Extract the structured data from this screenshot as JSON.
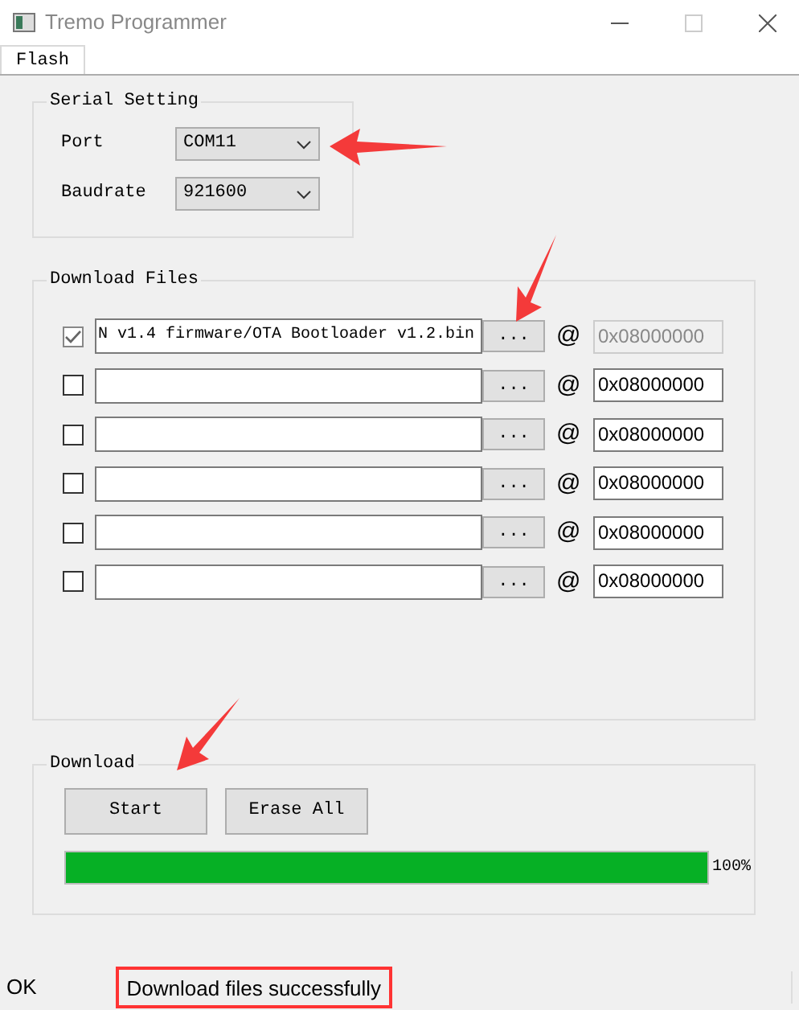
{
  "window": {
    "title": "Tremo Programmer"
  },
  "tabs": [
    {
      "label": "Flash",
      "selected": true
    }
  ],
  "serial_setting": {
    "title": "Serial Setting",
    "fields": [
      {
        "label": "Port",
        "value": "COM11"
      },
      {
        "label": "Baudrate",
        "value": "921600"
      }
    ]
  },
  "download_files": {
    "title": "Download Files",
    "rows": [
      {
        "checked": true,
        "file": "N v1.4 firmware/OTA Bootloader v1.2.bin",
        "browse": "...",
        "at": "@",
        "address": "0x08000000",
        "address_disabled": true
      },
      {
        "checked": false,
        "file": "",
        "browse": "...",
        "at": "@",
        "address": "0x08000000",
        "address_disabled": false
      },
      {
        "checked": false,
        "file": "",
        "browse": "...",
        "at": "@",
        "address": "0x08000000",
        "address_disabled": false
      },
      {
        "checked": false,
        "file": "",
        "browse": "...",
        "at": "@",
        "address": "0x08000000",
        "address_disabled": false
      },
      {
        "checked": false,
        "file": "",
        "browse": "...",
        "at": "@",
        "address": "0x08000000",
        "address_disabled": false
      },
      {
        "checked": false,
        "file": "",
        "browse": "...",
        "at": "@",
        "address": "0x08000000",
        "address_disabled": false
      }
    ]
  },
  "download": {
    "title": "Download",
    "buttons": [
      "Start",
      "Erase All"
    ],
    "progress": {
      "level": 1.0,
      "reading": "100%"
    }
  },
  "status_bar": {
    "state": "OK",
    "message": "Download files successfully",
    "message_highlighted": true
  }
}
